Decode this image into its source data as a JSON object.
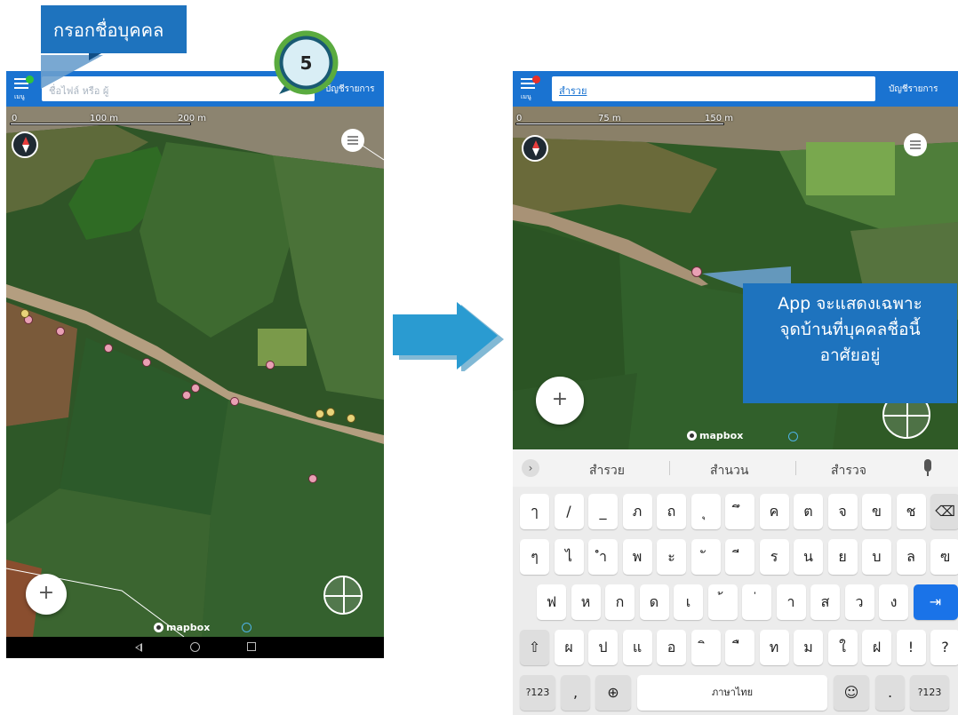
{
  "callouts": {
    "top": "กรอกชื่อบุคคล",
    "right_line1": "App จะแสดงเฉพาะ",
    "right_line2": "จุดบ้านที่บุคคลชื่อนี้",
    "right_line3": "อาศัยอยู่"
  },
  "step_badge": {
    "number": "5",
    "colors": {
      "ring": "#5aab3f",
      "fill": "#d9eef5",
      "tail": "#1a5a73"
    }
  },
  "colors": {
    "appbar": "#1a73d1",
    "callout": "#1e73be",
    "arrow": "#2a9bd1",
    "enter_key": "#1a73e8"
  },
  "left_screen": {
    "menu_label": "เมนู",
    "menu_status": "green",
    "search_placeholder": "ชื่อไฟล์ หรือ ผู้",
    "list_link": "บัญชีรายการ",
    "scale": {
      "zero": "0",
      "mid": "100 m",
      "end": "200 m"
    },
    "mapbox": "mapbox",
    "fab_label": "+",
    "nav_icons": [
      "back-icon",
      "home-icon",
      "recent-apps-icon"
    ]
  },
  "right_screen": {
    "menu_label": "เมนู",
    "menu_status": "red",
    "search_value": "สำรวย",
    "list_link": "บัญชีรายการ",
    "scale": {
      "zero": "0",
      "mid": "75 m",
      "end": "150 m"
    },
    "mapbox": "mapbox",
    "fab_label": "+",
    "keyboard": {
      "suggestions": [
        "สำรวย",
        "สำนวน",
        "สำรวจ"
      ],
      "row1": [
        "ๅ",
        "/",
        "_",
        "ภ",
        "ถ",
        "ุ",
        "ึ",
        "ค",
        "ต",
        "จ",
        "ข",
        "ช",
        "⌫"
      ],
      "row2": [
        "ๆ",
        "ไ",
        "ำ",
        "พ",
        "ะ",
        "ั",
        "ี",
        "ร",
        "น",
        "ย",
        "บ",
        "ล",
        "ฃ"
      ],
      "row3": [
        "ฟ",
        "ห",
        "ก",
        "ด",
        "เ",
        "้",
        "่",
        "า",
        "ส",
        "ว",
        "ง",
        "⇥"
      ],
      "row4": [
        "⇧",
        "ผ",
        "ป",
        "แ",
        "อ",
        "ิ",
        "ื",
        "ท",
        "ม",
        "ใ",
        "ฝ",
        "!",
        "?"
      ],
      "row5": {
        "sym_left": "?123",
        "comma": ",",
        "globe": "⊕",
        "space": "ภาษาไทย",
        "emoji": "☺",
        "period": ".",
        "sym_right": "?123"
      }
    }
  }
}
